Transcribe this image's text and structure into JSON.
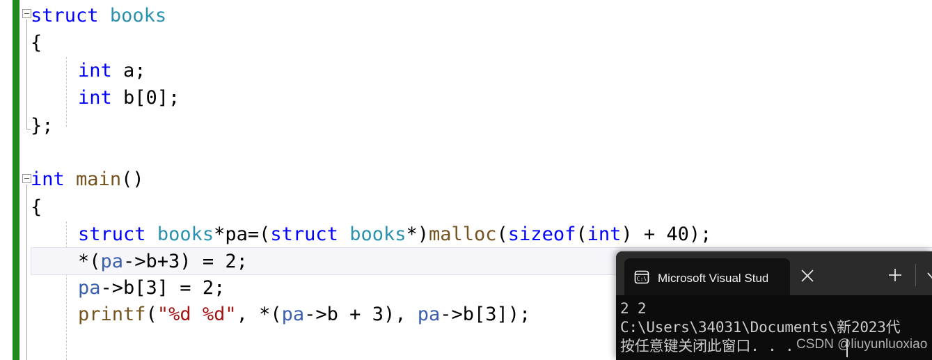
{
  "editor": {
    "name": "visual-studio-code-editor",
    "theme_colors": {
      "background": "#FFFFFF",
      "keyword": "#0000FF",
      "type": "#2B91AF",
      "function": "#74531F",
      "variable": "#3B5FAF",
      "string": "#A31515",
      "plain": "#000000",
      "change_track_saved": "#1E8A1E",
      "current_line_bg": "#F5F5FA",
      "squiggle_warning": "#12A112"
    },
    "lines": [
      {
        "n": 1,
        "indent": 0,
        "collapsible": true,
        "tokens": [
          {
            "t": "struct",
            "c": "kw"
          },
          {
            "t": " ",
            "c": "pln"
          },
          {
            "t": "books",
            "c": "type"
          }
        ]
      },
      {
        "n": 2,
        "indent": 0,
        "collapsible": false,
        "tokens": [
          {
            "t": "{",
            "c": "pln"
          }
        ]
      },
      {
        "n": 3,
        "indent": 1,
        "collapsible": false,
        "tokens": [
          {
            "t": "int",
            "c": "kw"
          },
          {
            "t": " a;",
            "c": "pln"
          }
        ]
      },
      {
        "n": 4,
        "indent": 1,
        "collapsible": false,
        "tokens": [
          {
            "t": "int",
            "c": "kw"
          },
          {
            "t": " b[0];",
            "c": "pln"
          }
        ]
      },
      {
        "n": 5,
        "indent": 0,
        "collapsible": false,
        "tokens": [
          {
            "t": "};",
            "c": "pln"
          }
        ]
      },
      {
        "n": 6,
        "indent": 0,
        "collapsible": false,
        "tokens": []
      },
      {
        "n": 7,
        "indent": 0,
        "collapsible": true,
        "tokens": [
          {
            "t": "int",
            "c": "kw"
          },
          {
            "t": " ",
            "c": "pln"
          },
          {
            "t": "main",
            "c": "fn"
          },
          {
            "t": "()",
            "c": "pln"
          }
        ]
      },
      {
        "n": 8,
        "indent": 0,
        "collapsible": false,
        "tokens": [
          {
            "t": "{",
            "c": "pln"
          }
        ]
      },
      {
        "n": 9,
        "indent": 1,
        "collapsible": false,
        "tokens": [
          {
            "t": "struct",
            "c": "kw"
          },
          {
            "t": " ",
            "c": "pln"
          },
          {
            "t": "books",
            "c": "type"
          },
          {
            "t": "*pa=(",
            "c": "pln"
          },
          {
            "t": "struct",
            "c": "kw"
          },
          {
            "t": " ",
            "c": "pln"
          },
          {
            "t": "books",
            "c": "type"
          },
          {
            "t": "*)",
            "c": "pln"
          },
          {
            "t": "malloc",
            "c": "fn"
          },
          {
            "t": "(",
            "c": "pln"
          },
          {
            "t": "sizeof",
            "c": "kw"
          },
          {
            "t": "(",
            "c": "pln"
          },
          {
            "t": "int",
            "c": "kw"
          },
          {
            "t": ") + 40);",
            "c": "pln"
          }
        ]
      },
      {
        "n": 10,
        "indent": 1,
        "collapsible": false,
        "current": true,
        "squiggle": true,
        "tokens": [
          {
            "t": "*(",
            "c": "pln"
          },
          {
            "t": "pa",
            "c": "var"
          },
          {
            "t": "->b+3) = 2;",
            "c": "pln"
          }
        ]
      },
      {
        "n": 11,
        "indent": 1,
        "collapsible": false,
        "tokens": [
          {
            "t": "pa",
            "c": "var"
          },
          {
            "t": "->b[3] = 2;",
            "c": "pln"
          }
        ]
      },
      {
        "n": 12,
        "indent": 1,
        "collapsible": false,
        "tokens": [
          {
            "t": "printf",
            "c": "fn"
          },
          {
            "t": "(",
            "c": "pln"
          },
          {
            "t": "\"%d %d\"",
            "c": "str"
          },
          {
            "t": ", *(",
            "c": "pln"
          },
          {
            "t": "pa",
            "c": "var"
          },
          {
            "t": "->b + 3), ",
            "c": "pln"
          },
          {
            "t": "pa",
            "c": "var"
          },
          {
            "t": "->b[3]);",
            "c": "pln"
          }
        ]
      }
    ]
  },
  "console": {
    "name": "debug-console-window",
    "tab": {
      "icon": "terminal-cmd-icon",
      "title": "Microsoft Visual Studio 调试控",
      "close_label": "✕"
    },
    "new_tab_label": "+",
    "dropdown_label": "⌄",
    "output": [
      "2 2",
      "C:\\Users\\34031\\Documents\\新2023代",
      "按任意键关闭此窗口. . ."
    ]
  },
  "watermark": {
    "text": "CSDN @liuyunluoxiao"
  }
}
